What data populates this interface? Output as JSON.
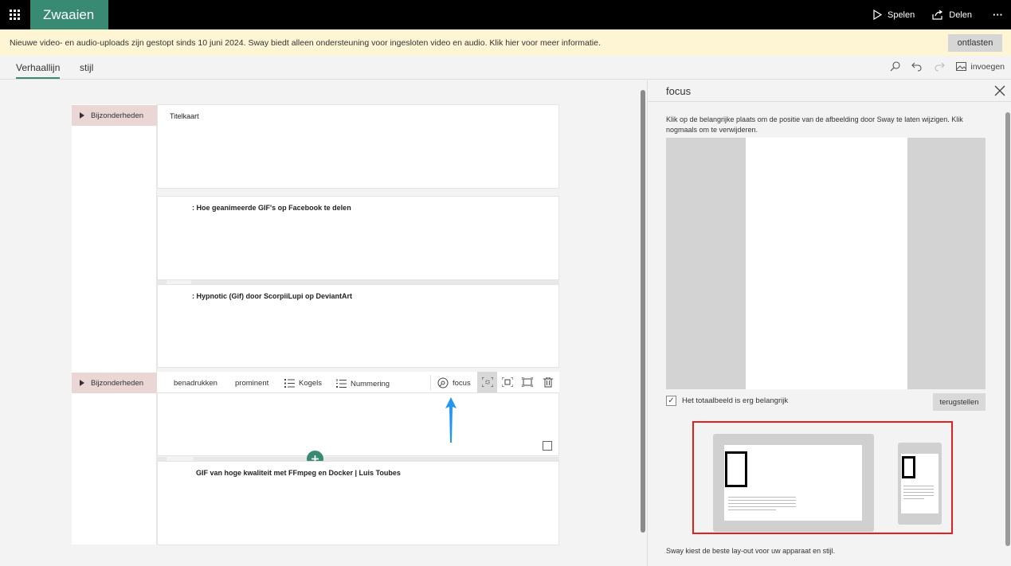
{
  "topbar": {
    "app_name": "Zwaaien",
    "play_label": "Spelen",
    "share_label": "Delen",
    "more_label": "···"
  },
  "banner": {
    "message": "Nieuwe video- en audio-uploads zijn gestopt sinds 10 juni 2024. Sway biedt alleen ondersteuning voor ingesloten video en audio. Klik hier voor meer informatie.",
    "dismiss_label": "ontlasten"
  },
  "tabs": {
    "storyline": "Verhaallijn",
    "style": "stijl",
    "insert": "invoegen"
  },
  "storyline": {
    "section_heading_1": "Bijzonderheden",
    "title_card": "Titelkaart",
    "card_1": ": Hoe geanimeerde GIF's op Facebook te delen",
    "card_2": ": Hypnotic (Gif) door ScorpiiLupi op DeviantArt",
    "section_heading_2": "Bijzonderheden",
    "card_3": "GIF van hoge kwaliteit met FFmpeg en Docker | Luis Toubes"
  },
  "toolbar": {
    "emphasize": "benadrukken",
    "prominent": "prominent",
    "bullets": "Kogels",
    "numbering": "Nummering",
    "focus": "focus"
  },
  "panel": {
    "title": "focus",
    "description": "Klik op de belangrijke plaats om de positie van de afbeelding door Sway te laten wijzigen. Klik nogmaals om te verwijderen.",
    "checkbox_label": "Het totaalbeeld is erg belangrijk",
    "checkbox_checked": true,
    "reset_label": "terugstellen",
    "footer": "Sway kiest de beste lay-out voor uw apparaat en stijl."
  },
  "colors": {
    "accent": "#388a73",
    "banner_bg": "#fdf5d4",
    "heading_tab": "#ead7d5",
    "highlight_border": "#e02020",
    "arrow": "#2196f3"
  }
}
